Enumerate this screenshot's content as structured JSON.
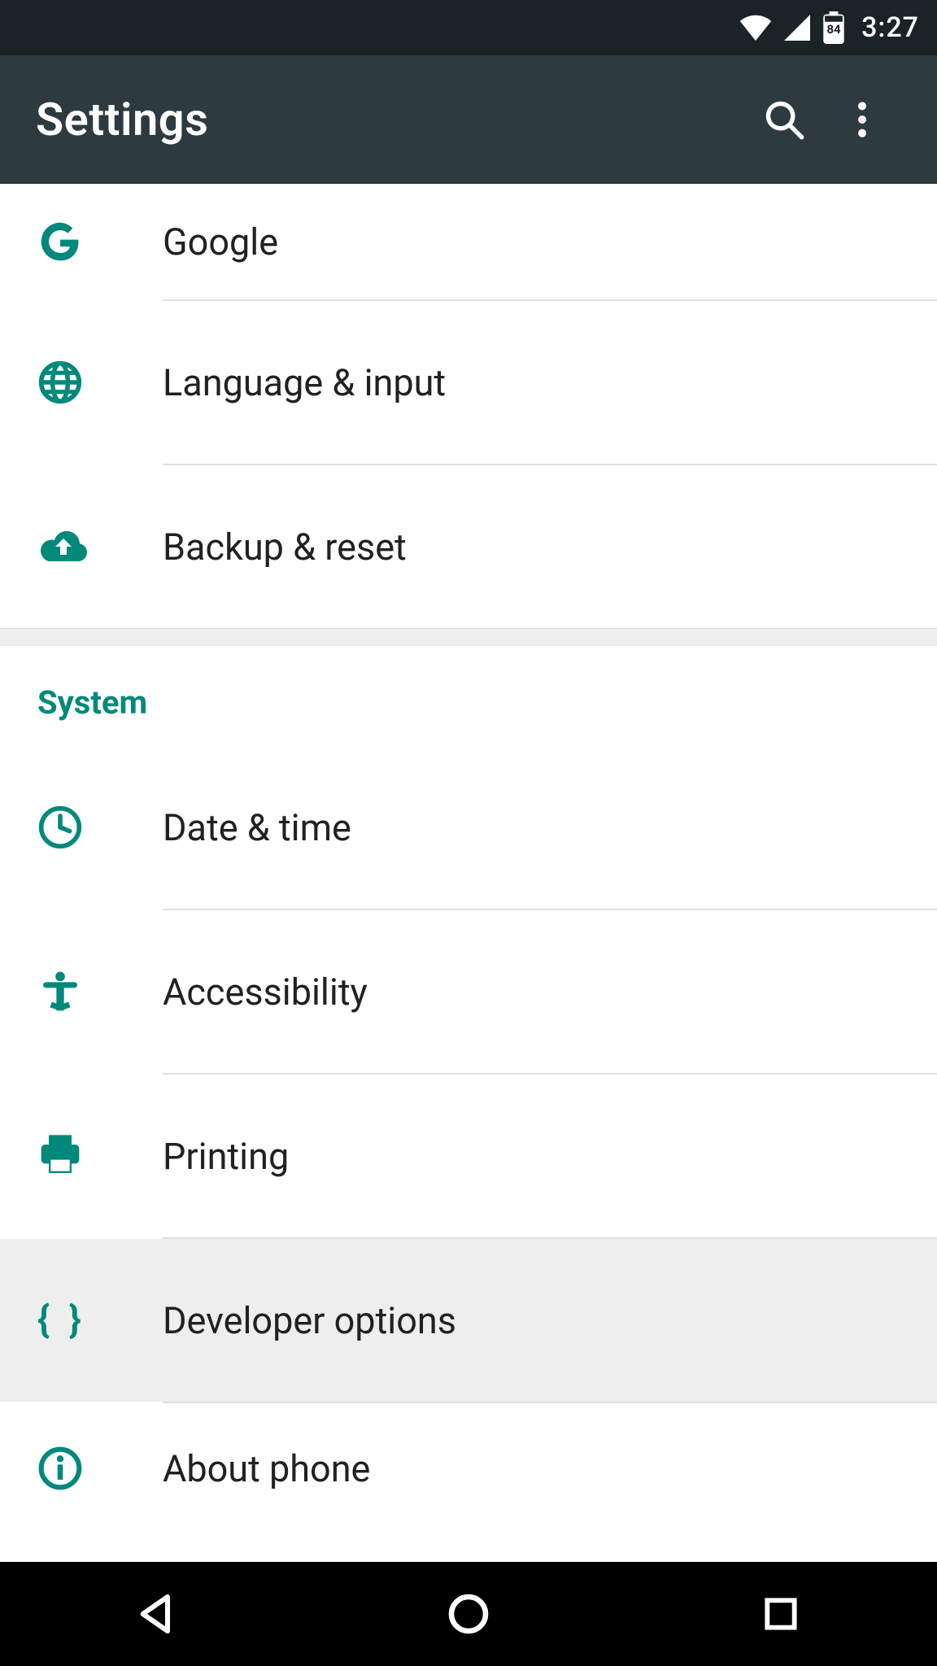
{
  "status": {
    "batteryText": "84",
    "time": "3:27"
  },
  "appbar": {
    "title": "Settings"
  },
  "section_personal": {
    "google": "Google",
    "language": "Language & input",
    "backup": "Backup & reset"
  },
  "section_system_header": "System",
  "section_system": {
    "datetime": "Date & time",
    "accessibility": "Accessibility",
    "printing": "Printing",
    "developer": "Developer options",
    "about": "About phone"
  },
  "accent": "#00897b"
}
